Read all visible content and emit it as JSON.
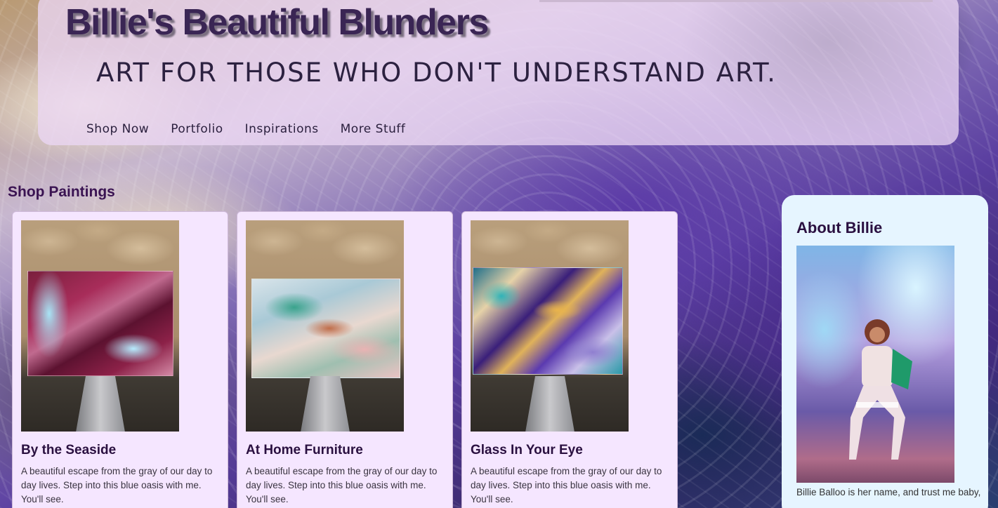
{
  "header": {
    "title": "Billie's Beautiful Blunders",
    "tagline": "ART FOR THOSE WHO DON'T UNDERSTAND ART."
  },
  "nav": {
    "items": [
      {
        "label": "Shop Now"
      },
      {
        "label": "Portfolio"
      },
      {
        "label": "Inspirations"
      },
      {
        "label": "More Stuff"
      }
    ]
  },
  "shop": {
    "title": "Shop Paintings",
    "cards": [
      {
        "name": "By the Seaside",
        "description": "A beautiful escape from the gray of our day to day lives. Step into this blue oasis with me. You'll see."
      },
      {
        "name": "At Home Furniture",
        "description": "A beautiful escape from the gray of our day to day lives. Step into this blue oasis with me. You'll see."
      },
      {
        "name": "Glass In Your Eye",
        "description": "A beautiful escape from the gray of our day to day lives. Step into this blue oasis with me. You'll see."
      }
    ]
  },
  "about": {
    "title": "About Billie",
    "bio": "Billie Balloo is her name, and trust me baby,"
  },
  "colors": {
    "header_bg": "#ead6f4",
    "card_bg": "#f5e6ff",
    "about_bg": "#e6f5ff",
    "title_color": "#3a2554",
    "heading_color": "#2a1040"
  }
}
